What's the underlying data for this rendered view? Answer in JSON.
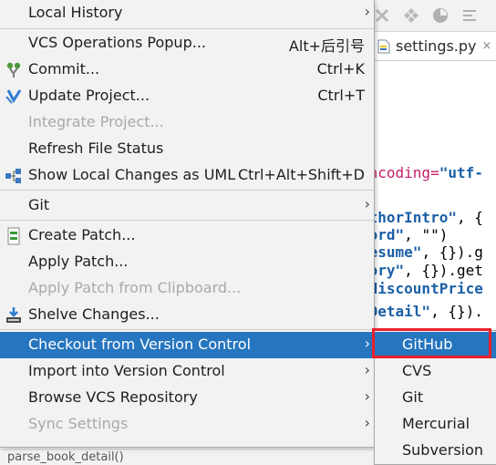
{
  "editor": {
    "tab_file": "settings.py",
    "tab_close": "×",
    "code_lines": [
      {
        "segments": [
          {
            "text": "encoding=",
            "cls": "attr"
          },
          {
            "text": "\"utf-",
            "cls": "str"
          }
        ]
      },
      {
        "segments": [
          {
            "text": "uthorIntro\"",
            "cls": "str"
          },
          {
            "text": ", {",
            "cls": ""
          }
        ]
      },
      {
        "segments": [
          {
            "text": "Word\"",
            "cls": "str"
          },
          {
            "text": ", \"\")",
            "cls": ""
          }
        ]
      },
      {
        "segments": [
          {
            "text": "resume\"",
            "cls": "str"
          },
          {
            "text": ", {}).g",
            "cls": ""
          }
        ]
      },
      {
        "segments": [
          {
            "text": "tory\"",
            "cls": "str"
          },
          {
            "text": ", {}).get",
            "cls": ""
          }
        ]
      },
      {
        "segments": [
          {
            "text": "'discountPrice",
            "cls": "str"
          }
        ]
      },
      {
        "segments": [
          {
            "text": "kDetail\"",
            "cls": "str"
          },
          {
            "text": ", {}).",
            "cls": ""
          }
        ]
      }
    ],
    "status_line": "parse_book_detail()"
  },
  "menu": {
    "items": [
      {
        "label": "Local History",
        "mnemonic": 6,
        "arrow": true
      },
      {
        "label": "VCS Operations Popup...",
        "shortcut": "Alt+后引号"
      },
      {
        "label": "Commit...",
        "shortcut": "Ctrl+K",
        "icon": "commit-icon"
      },
      {
        "label": "Update Project...",
        "shortcut": "Ctrl+T",
        "icon": "update-project-icon"
      },
      {
        "label": "Integrate Project...",
        "disabled": true
      },
      {
        "label": "Refresh File Status"
      },
      {
        "label": "Show Local Changes as UML",
        "shortcut": "Ctrl+Alt+Shift+D",
        "icon": "uml-diagram-icon"
      },
      {
        "label": "Git",
        "arrow": true
      },
      {
        "label": "Create Patch...",
        "icon": "create-patch-icon"
      },
      {
        "label": "Apply Patch..."
      },
      {
        "label": "Apply Patch from Clipboard...",
        "disabled": true
      },
      {
        "label": "Shelve Changes...",
        "icon": "shelve-icon"
      },
      {
        "label": "Checkout from Version Control",
        "arrow": true,
        "selected": true
      },
      {
        "label": "Import into Version Control",
        "arrow": true
      },
      {
        "label": "Browse VCS Repository",
        "arrow": true
      },
      {
        "label": "Sync Settings",
        "arrow": true,
        "disabled": true
      }
    ],
    "arrow_glyph": "›"
  },
  "submenu": {
    "items": [
      {
        "label": "GitHub",
        "selected": true
      },
      {
        "label": "CVS"
      },
      {
        "label": "Git"
      },
      {
        "label": "Mercurial"
      },
      {
        "label": "Subversion"
      }
    ]
  },
  "colors": {
    "selection": "#2675bf",
    "highlight_border": "#e8222d"
  }
}
